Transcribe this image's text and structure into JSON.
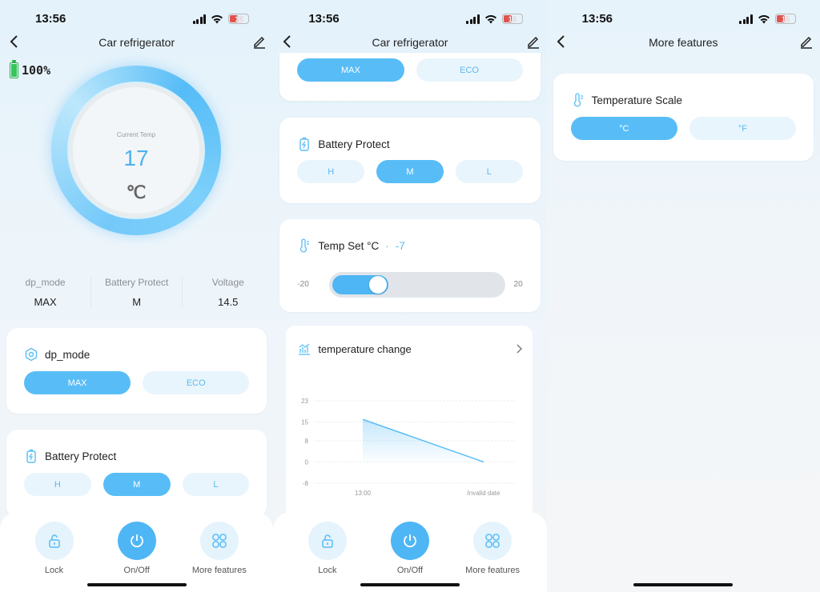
{
  "status": {
    "time": "13:56",
    "battery": "12"
  },
  "screen1": {
    "title": "Car refrigerator",
    "battery_level": "100%",
    "current_temp_label": "Current Temp",
    "current_temp_value": "17",
    "temp_unit": "℃",
    "stats": [
      {
        "label": "dp_mode",
        "value": "MAX"
      },
      {
        "label": "Battery Protect",
        "value": "M"
      },
      {
        "label": "Voltage",
        "value": "14.5"
      }
    ],
    "dp_mode": {
      "title": "dp_mode",
      "options": [
        "MAX",
        "ECO"
      ],
      "selected": "MAX"
    },
    "battery_protect": {
      "title": "Battery Protect",
      "options": [
        "H",
        "M",
        "L"
      ],
      "selected": "M"
    }
  },
  "screen2": {
    "title": "Car refrigerator",
    "dp_mode_options": [
      "MAX",
      "ECO"
    ],
    "battery_protect": {
      "title": "Battery Protect",
      "options": [
        "H",
        "M",
        "L"
      ],
      "selected": "M"
    },
    "temp_set": {
      "title": "Temp Set °C",
      "separator": "·",
      "value": "-7",
      "min": "-20",
      "max": "20",
      "level": 0.33
    },
    "temp_change": {
      "title": "temperature change"
    }
  },
  "screen3": {
    "title": "More features",
    "temp_scale": {
      "title": "Temperature Scale",
      "options": [
        "°C",
        "°F"
      ],
      "selected": "°C"
    }
  },
  "bottom_nav": [
    "Lock",
    "On/Off",
    "More features"
  ],
  "colors": {
    "accent": "#58bdf6",
    "pill_bg": "#e9f5fc"
  },
  "chart_data": {
    "type": "area",
    "title": "",
    "xlabel": "",
    "ylabel": "",
    "y_ticks": [
      "23",
      "15",
      "8",
      "0",
      "-8"
    ],
    "x_ticks": [
      "13:00",
      "Invalid date"
    ],
    "ylim": [
      -8,
      23
    ],
    "grid": true,
    "series": [
      {
        "values": [
          {
            "x": "13:00",
            "y": 16
          },
          {
            "x": "Invalid date",
            "y": 0
          }
        ]
      }
    ]
  }
}
